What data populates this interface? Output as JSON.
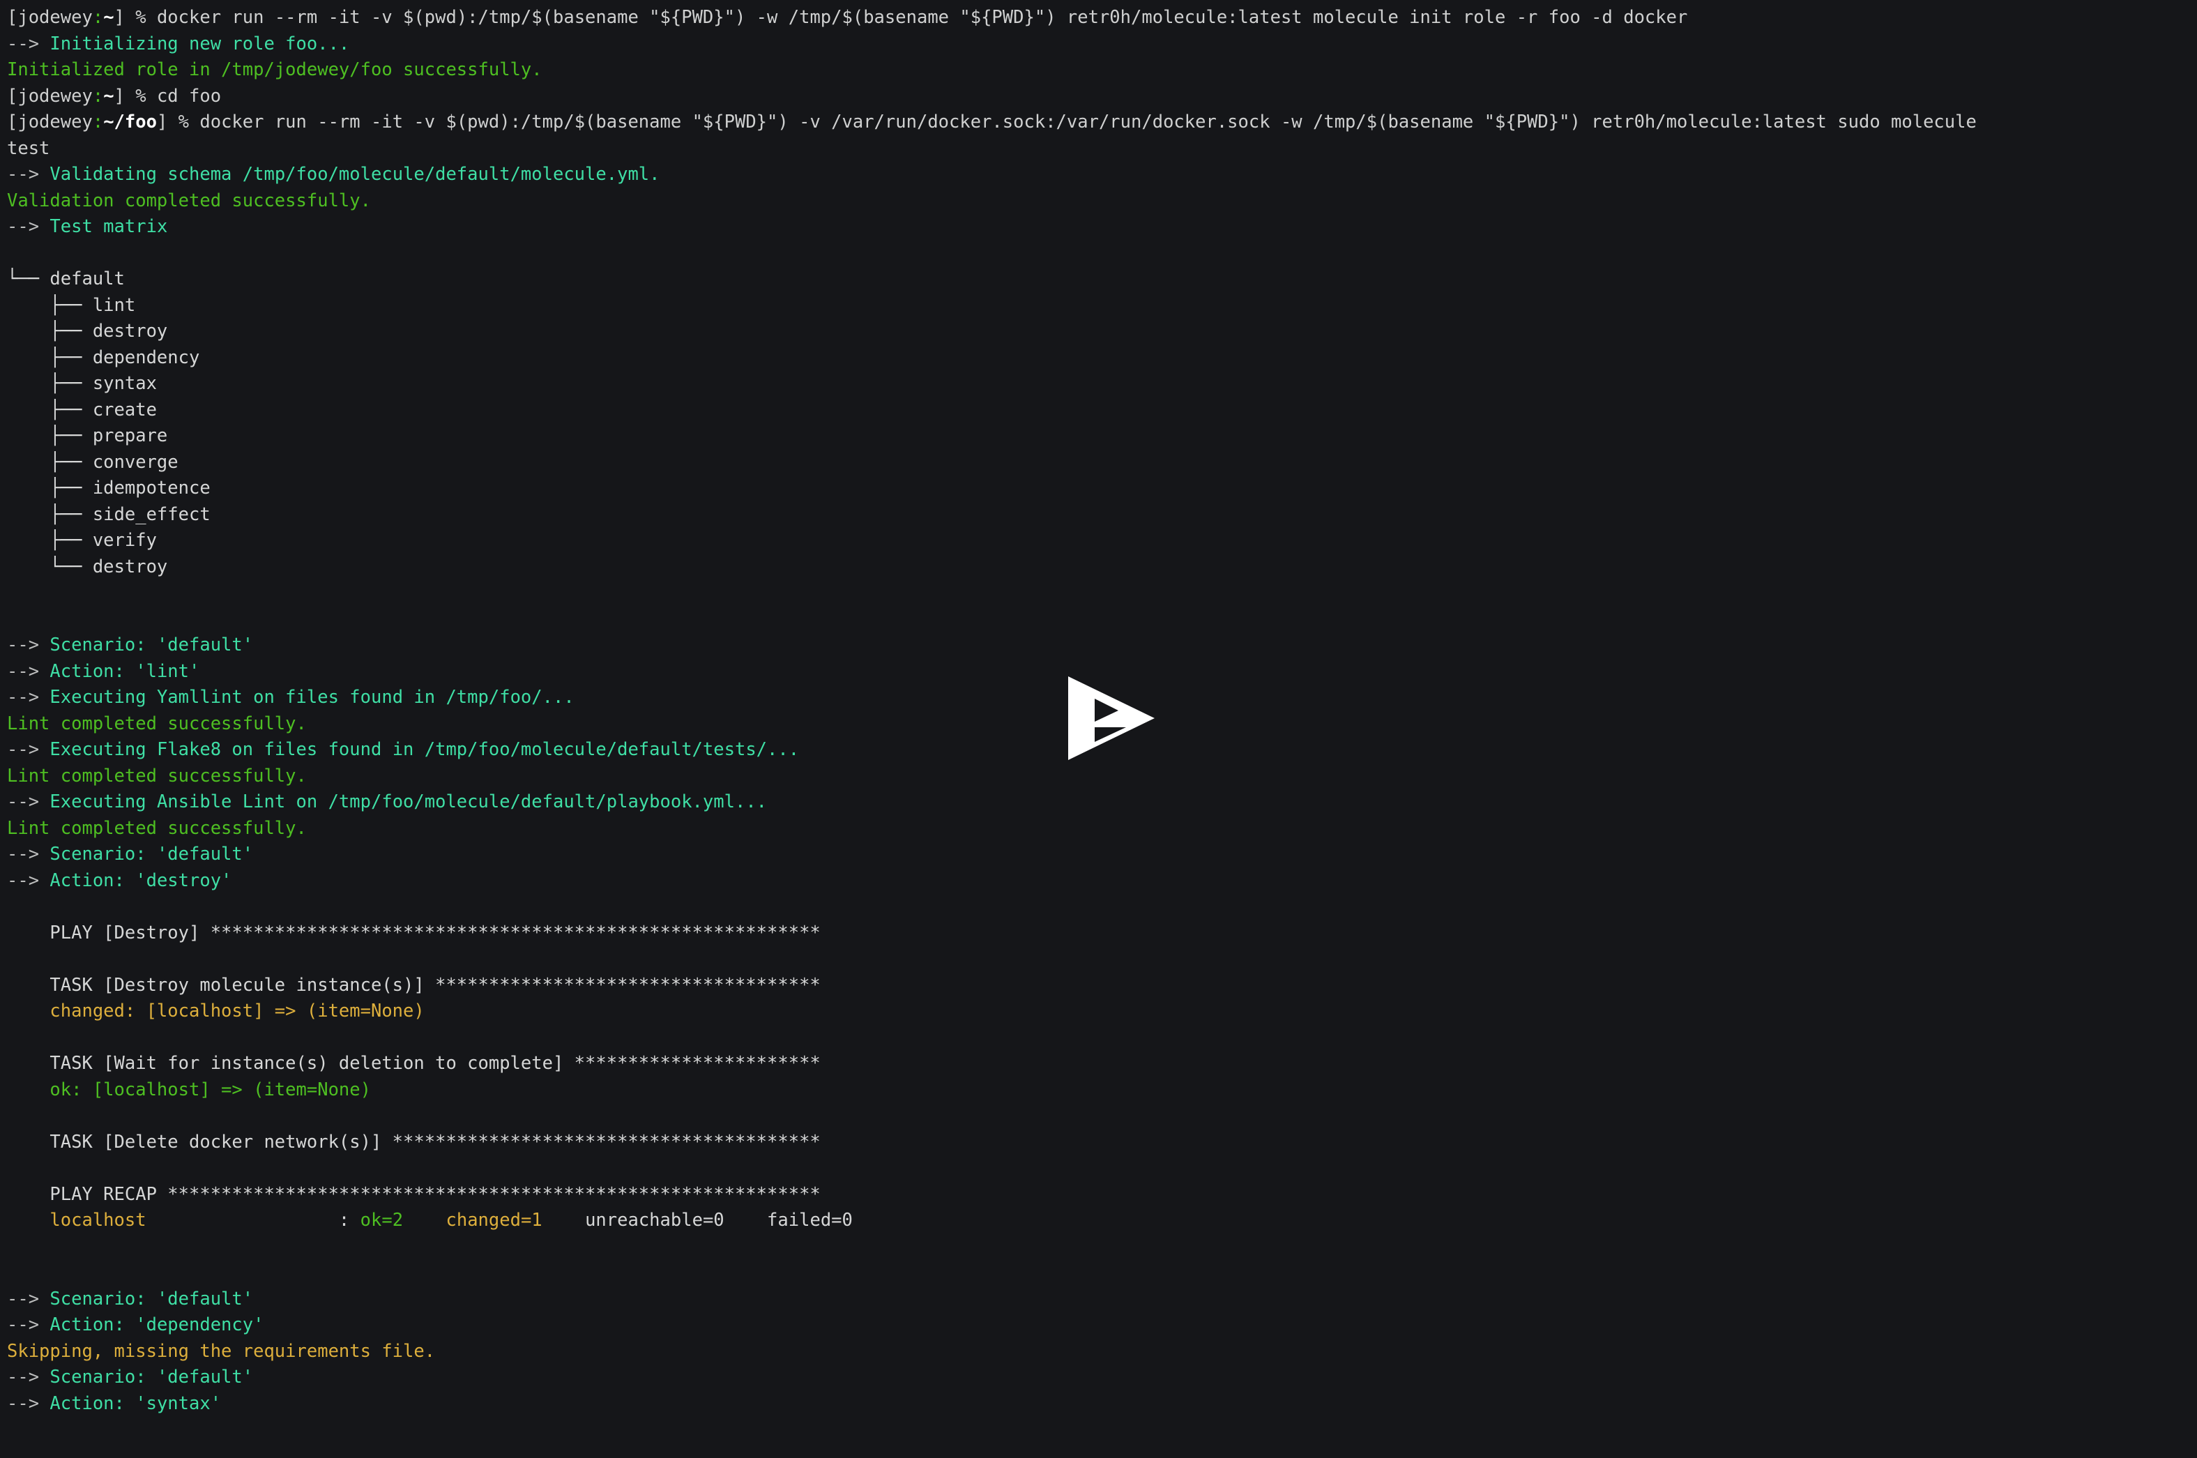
{
  "terminal": {
    "background_color": "#151619",
    "foreground_color": "#cfd0d0",
    "colors": {
      "green": "#4ebf22",
      "cyan": "#3fdfa5",
      "yellow": "#ddaf3c",
      "white": "#d6d7d7",
      "bold_white": "#ffffff"
    },
    "columns": 124,
    "rows": 55
  },
  "overlay": {
    "play_button_label": "play-button",
    "color": "#ffffff"
  },
  "lines": [
    {
      "id": "line-001",
      "name": "prompt-line-docker-init",
      "spans": [
        {
          "text": "[jodewey",
          "style": "fg-default"
        },
        {
          "text": ":",
          "style": "fg-green"
        },
        {
          "text": "~",
          "style": "fg-bold"
        },
        {
          "text": "] % docker run --rm -it -v $(pwd):/tmp/$(basename \"${PWD}\") -w /tmp/$(basename \"${PWD}\") retr0h/molecule:latest molecule init role -r foo -d docker",
          "style": "fg-default"
        }
      ]
    },
    {
      "id": "line-002",
      "name": "output-initializing-role",
      "spans": [
        {
          "text": "--> ",
          "style": "fg-grey"
        },
        {
          "text": "Initializing new role foo...",
          "style": "fg-cyan"
        }
      ]
    },
    {
      "id": "line-003",
      "name": "output-initialized-role",
      "spans": [
        {
          "text": "Initialized role in /tmp/jodewey/foo successfully.",
          "style": "fg-green"
        }
      ]
    },
    {
      "id": "line-004",
      "name": "prompt-line-cd-foo",
      "spans": [
        {
          "text": "[jodewey",
          "style": "fg-default"
        },
        {
          "text": ":",
          "style": "fg-green"
        },
        {
          "text": "~",
          "style": "fg-bold"
        },
        {
          "text": "] % cd foo",
          "style": "fg-default"
        }
      ]
    },
    {
      "id": "line-005",
      "name": "prompt-line-molecule-test",
      "spans": [
        {
          "text": "[jodewey",
          "style": "fg-default"
        },
        {
          "text": ":",
          "style": "fg-green"
        },
        {
          "text": "~/foo",
          "style": "fg-bold"
        },
        {
          "text": "] % docker run --rm -it -v $(pwd):/tmp/$(basename \"${PWD}\") -v /var/run/docker.sock:/var/run/docker.sock -w /tmp/$(basename \"${PWD}\") retr0h/molecule:latest sudo molecule",
          "style": "fg-default"
        }
      ]
    },
    {
      "id": "line-006",
      "name": "prompt-line-molecule-test-wrap",
      "spans": [
        {
          "text": "test",
          "style": "fg-default"
        }
      ]
    },
    {
      "id": "line-007",
      "name": "output-validating-schema",
      "spans": [
        {
          "text": "--> ",
          "style": "fg-grey"
        },
        {
          "text": "Validating schema /tmp/foo/molecule/default/molecule.yml.",
          "style": "fg-cyan"
        }
      ]
    },
    {
      "id": "line-008",
      "name": "output-validation-completed",
      "spans": [
        {
          "text": "Validation completed successfully.",
          "style": "fg-green"
        }
      ]
    },
    {
      "id": "line-009",
      "name": "output-test-matrix-header",
      "spans": [
        {
          "text": "--> ",
          "style": "fg-grey"
        },
        {
          "text": "Test matrix",
          "style": "fg-cyan"
        }
      ]
    },
    {
      "id": "line-010",
      "name": "blank-line",
      "spans": []
    },
    {
      "id": "line-011",
      "name": "matrix-node-default",
      "spans": [
        {
          "text": "└── default",
          "style": "fg-white"
        }
      ]
    },
    {
      "id": "line-012",
      "name": "matrix-node-lint",
      "spans": [
        {
          "text": "    ├── lint",
          "style": "fg-white"
        }
      ]
    },
    {
      "id": "line-013",
      "name": "matrix-node-destroy-1",
      "spans": [
        {
          "text": "    ├── destroy",
          "style": "fg-white"
        }
      ]
    },
    {
      "id": "line-014",
      "name": "matrix-node-dependency",
      "spans": [
        {
          "text": "    ├── dependency",
          "style": "fg-white"
        }
      ]
    },
    {
      "id": "line-015",
      "name": "matrix-node-syntax",
      "spans": [
        {
          "text": "    ├── syntax",
          "style": "fg-white"
        }
      ]
    },
    {
      "id": "line-016",
      "name": "matrix-node-create",
      "spans": [
        {
          "text": "    ├── create",
          "style": "fg-white"
        }
      ]
    },
    {
      "id": "line-017",
      "name": "matrix-node-prepare",
      "spans": [
        {
          "text": "    ├── prepare",
          "style": "fg-white"
        }
      ]
    },
    {
      "id": "line-018",
      "name": "matrix-node-converge",
      "spans": [
        {
          "text": "    ├── converge",
          "style": "fg-white"
        }
      ]
    },
    {
      "id": "line-019",
      "name": "matrix-node-idempotence",
      "spans": [
        {
          "text": "    ├── idempotence",
          "style": "fg-white"
        }
      ]
    },
    {
      "id": "line-020",
      "name": "matrix-node-side-effect",
      "spans": [
        {
          "text": "    ├── side_effect",
          "style": "fg-white"
        }
      ]
    },
    {
      "id": "line-021",
      "name": "matrix-node-verify",
      "spans": [
        {
          "text": "    ├── verify",
          "style": "fg-white"
        }
      ]
    },
    {
      "id": "line-022",
      "name": "matrix-node-destroy-2",
      "spans": [
        {
          "text": "    └── destroy",
          "style": "fg-white"
        }
      ]
    },
    {
      "id": "line-023",
      "name": "blank-line",
      "spans": []
    },
    {
      "id": "line-024",
      "name": "blank-line",
      "spans": []
    },
    {
      "id": "line-025",
      "name": "output-scenario-default-1",
      "spans": [
        {
          "text": "--> ",
          "style": "fg-grey"
        },
        {
          "text": "Scenario: 'default'",
          "style": "fg-cyan"
        }
      ]
    },
    {
      "id": "line-026",
      "name": "output-action-lint",
      "spans": [
        {
          "text": "--> ",
          "style": "fg-grey"
        },
        {
          "text": "Action: 'lint'",
          "style": "fg-cyan"
        }
      ]
    },
    {
      "id": "line-027",
      "name": "output-executing-yamllint",
      "spans": [
        {
          "text": "--> ",
          "style": "fg-grey"
        },
        {
          "text": "Executing Yamllint on files found in /tmp/foo/...",
          "style": "fg-cyan"
        }
      ]
    },
    {
      "id": "line-028",
      "name": "output-lint-completed-1",
      "spans": [
        {
          "text": "Lint completed successfully.",
          "style": "fg-green"
        }
      ]
    },
    {
      "id": "line-029",
      "name": "output-executing-flake8",
      "spans": [
        {
          "text": "--> ",
          "style": "fg-grey"
        },
        {
          "text": "Executing Flake8 on files found in /tmp/foo/molecule/default/tests/...",
          "style": "fg-cyan"
        }
      ]
    },
    {
      "id": "line-030",
      "name": "output-lint-completed-2",
      "spans": [
        {
          "text": "Lint completed successfully.",
          "style": "fg-green"
        }
      ]
    },
    {
      "id": "line-031",
      "name": "output-executing-ansible-lint",
      "spans": [
        {
          "text": "--> ",
          "style": "fg-grey"
        },
        {
          "text": "Executing Ansible Lint on /tmp/foo/molecule/default/playbook.yml...",
          "style": "fg-cyan"
        }
      ]
    },
    {
      "id": "line-032",
      "name": "output-lint-completed-3",
      "spans": [
        {
          "text": "Lint completed successfully.",
          "style": "fg-green"
        }
      ]
    },
    {
      "id": "line-033",
      "name": "output-scenario-default-2",
      "spans": [
        {
          "text": "--> ",
          "style": "fg-grey"
        },
        {
          "text": "Scenario: 'default'",
          "style": "fg-cyan"
        }
      ]
    },
    {
      "id": "line-034",
      "name": "output-action-destroy",
      "spans": [
        {
          "text": "--> ",
          "style": "fg-grey"
        },
        {
          "text": "Action: 'destroy'",
          "style": "fg-cyan"
        }
      ]
    },
    {
      "id": "line-035",
      "name": "blank-line",
      "spans": []
    },
    {
      "id": "line-036",
      "name": "ansible-play-destroy",
      "spans": [
        {
          "text": "    PLAY [Destroy] *********************************************************",
          "style": "fg-white"
        }
      ]
    },
    {
      "id": "line-037",
      "name": "blank-line",
      "spans": []
    },
    {
      "id": "line-038",
      "name": "ansible-task-destroy-instances",
      "spans": [
        {
          "text": "    TASK [Destroy molecule instance(s)] ************************************",
          "style": "fg-white"
        }
      ]
    },
    {
      "id": "line-039",
      "name": "ansible-result-changed",
      "spans": [
        {
          "text": "    changed: [localhost] => (item=None)",
          "style": "fg-yellow"
        }
      ]
    },
    {
      "id": "line-040",
      "name": "blank-line",
      "spans": []
    },
    {
      "id": "line-041",
      "name": "ansible-task-wait-deletion",
      "spans": [
        {
          "text": "    TASK [Wait for instance(s) deletion to complete] ***********************",
          "style": "fg-white"
        }
      ]
    },
    {
      "id": "line-042",
      "name": "ansible-result-ok",
      "spans": [
        {
          "text": "    ok: [localhost] => (item=None)",
          "style": "fg-green"
        }
      ]
    },
    {
      "id": "line-043",
      "name": "blank-line",
      "spans": []
    },
    {
      "id": "line-044",
      "name": "ansible-task-delete-network",
      "spans": [
        {
          "text": "    TASK [Delete docker network(s)] ****************************************",
          "style": "fg-white"
        }
      ]
    },
    {
      "id": "line-045",
      "name": "blank-line",
      "spans": []
    },
    {
      "id": "line-046",
      "name": "ansible-play-recap-header",
      "spans": [
        {
          "text": "    PLAY RECAP *************************************************************",
          "style": "fg-white"
        }
      ]
    },
    {
      "id": "line-047",
      "name": "ansible-play-recap-row",
      "spans": [
        {
          "text": "    ",
          "style": "fg-default"
        },
        {
          "text": "localhost",
          "style": "fg-yellow"
        },
        {
          "text": "                  : ",
          "style": "fg-white"
        },
        {
          "text": "ok=2",
          "style": "fg-green"
        },
        {
          "text": "    ",
          "style": "fg-white"
        },
        {
          "text": "changed=1",
          "style": "fg-yellow"
        },
        {
          "text": "    unreachable=0    failed=0",
          "style": "fg-white"
        }
      ]
    },
    {
      "id": "line-048",
      "name": "blank-line",
      "spans": []
    },
    {
      "id": "line-049",
      "name": "blank-line",
      "spans": []
    },
    {
      "id": "line-050",
      "name": "output-scenario-default-3",
      "spans": [
        {
          "text": "--> ",
          "style": "fg-grey"
        },
        {
          "text": "Scenario: 'default'",
          "style": "fg-cyan"
        }
      ]
    },
    {
      "id": "line-051",
      "name": "output-action-dependency",
      "spans": [
        {
          "text": "--> ",
          "style": "fg-grey"
        },
        {
          "text": "Action: 'dependency'",
          "style": "fg-cyan"
        }
      ]
    },
    {
      "id": "line-052",
      "name": "output-skipping-requirements",
      "spans": [
        {
          "text": "Skipping, missing the requirements file.",
          "style": "fg-yellow"
        }
      ]
    },
    {
      "id": "line-053",
      "name": "output-scenario-default-4",
      "spans": [
        {
          "text": "--> ",
          "style": "fg-grey"
        },
        {
          "text": "Scenario: 'default'",
          "style": "fg-cyan"
        }
      ]
    },
    {
      "id": "line-054",
      "name": "output-action-syntax",
      "spans": [
        {
          "text": "--> ",
          "style": "fg-grey"
        },
        {
          "text": "Action: 'syntax'",
          "style": "fg-cyan"
        }
      ]
    }
  ]
}
